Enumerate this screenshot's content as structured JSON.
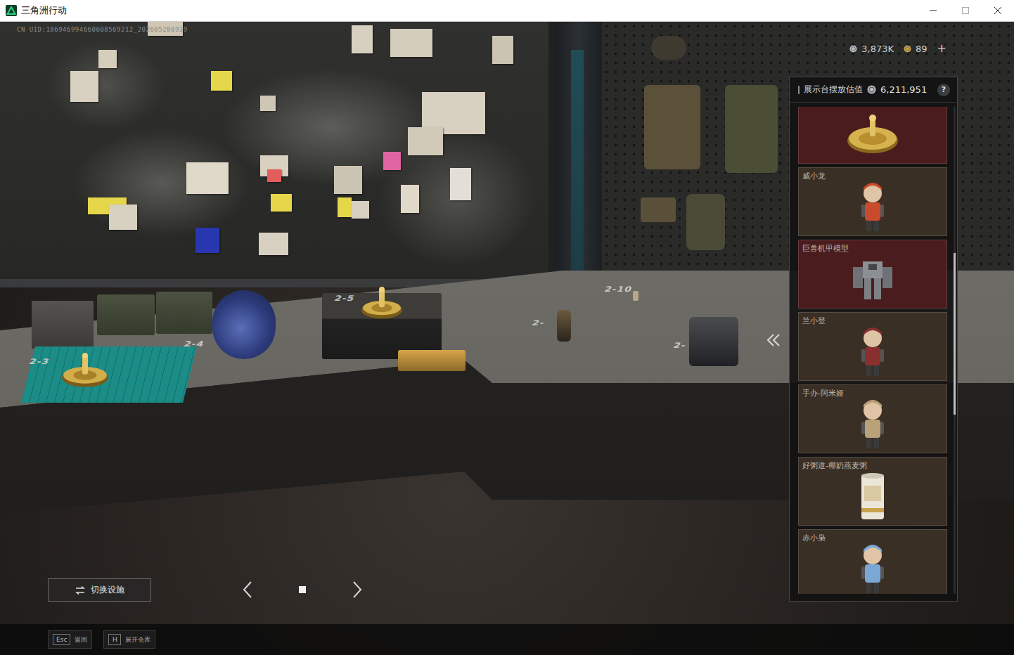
{
  "window": {
    "title": "三角洲行动"
  },
  "uid": "CN UID:186946994660608569212_202605280939",
  "currency": [
    {
      "amount": "3,873K",
      "kind": "silver"
    },
    {
      "amount": "89",
      "kind": "gold"
    }
  ],
  "add_button": "+",
  "desk_slots": [
    {
      "label": "2-3"
    },
    {
      "label": "2-4"
    },
    {
      "label": "2-5"
    },
    {
      "label": "2-"
    },
    {
      "label": "2-10"
    },
    {
      "label": "2-"
    }
  ],
  "showcase": {
    "title": "展示台摆放估值",
    "value": "6,211,951",
    "help": "?",
    "scroll_level": 0.3,
    "items": [
      {
        "label": "",
        "kind": "disc",
        "color": "#4a1c1e"
      },
      {
        "label": "威小龙",
        "kind": "figure",
        "color": "#3a2f25"
      },
      {
        "label": "巨兽机甲模型",
        "kind": "mech",
        "color": "#4a1c1e"
      },
      {
        "label": "兰小登",
        "kind": "figure",
        "color": "#3a2f25"
      },
      {
        "label": "手办-阿米娅",
        "kind": "figure",
        "color": "#3a2f25"
      },
      {
        "label": "好粥道-椰奶燕麦粥",
        "kind": "can",
        "color": "#3a2f25"
      },
      {
        "label": "赤小枭",
        "kind": "figure",
        "color": "#3a2f25"
      }
    ]
  },
  "switch_button": "切换设施",
  "pager": {
    "pages": [
      {
        "selected": false
      },
      {
        "selected": true
      },
      {
        "selected": false
      }
    ]
  },
  "hotkeys": [
    {
      "key": "Esc",
      "label": "返回"
    },
    {
      "key": "H",
      "label": "展开仓库"
    }
  ]
}
